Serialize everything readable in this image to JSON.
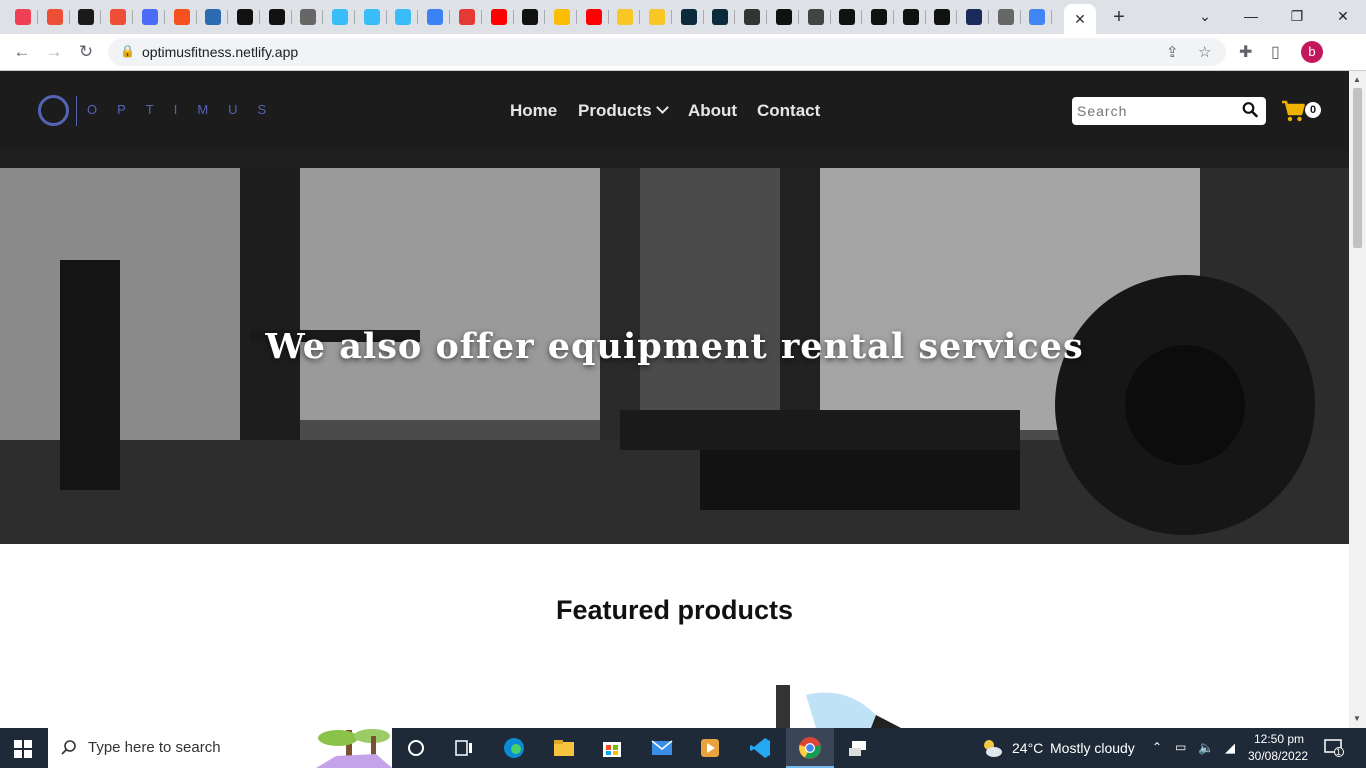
{
  "browser": {
    "url": "optimusfitness.netlify.app",
    "tabs": [
      {
        "icon": "pocket-icon",
        "color": "#ef4056"
      },
      {
        "icon": "asterisk-icon",
        "color": "#ef4e36"
      },
      {
        "icon": "chart-icon",
        "color": "#1a1a1a"
      },
      {
        "icon": "asterisk-icon",
        "color": "#ef4e36"
      },
      {
        "icon": "puzzle-icon",
        "color": "#4a6cf7"
      },
      {
        "icon": "flame-icon",
        "color": "#f4511e"
      },
      {
        "icon": "arrow-icon",
        "color": "#2b6cb0"
      },
      {
        "icon": "circle-icon",
        "color": "#111111"
      },
      {
        "icon": "github-icon",
        "color": "#111111"
      },
      {
        "icon": "globe-icon",
        "color": "#666666"
      },
      {
        "icon": "tailwind-icon",
        "color": "#38bdf8"
      },
      {
        "icon": "tailwind-icon",
        "color": "#38bdf8"
      },
      {
        "icon": "tailwind-icon",
        "color": "#38bdf8"
      },
      {
        "icon": "bot-icon",
        "color": "#3b82f6"
      },
      {
        "icon": "bolt-icon",
        "color": "#e53935"
      },
      {
        "icon": "youtube-icon",
        "color": "#ff0000"
      },
      {
        "icon": "github-icon",
        "color": "#111111"
      },
      {
        "icon": "drive-icon",
        "color": "#fbbc04"
      },
      {
        "icon": "youtube-icon",
        "color": "#ff0000"
      },
      {
        "icon": "sun-icon",
        "color": "#f9c623"
      },
      {
        "icon": "sun-icon",
        "color": "#f9c623"
      },
      {
        "icon": "react-icon",
        "color": "#0b2a3c"
      },
      {
        "icon": "react-icon",
        "color": "#0b2a3c"
      },
      {
        "icon": "w-icon",
        "color": "#333333"
      },
      {
        "icon": "a-icon",
        "color": "#111111"
      },
      {
        "icon": "person-icon",
        "color": "#444444"
      },
      {
        "icon": "n-icon",
        "color": "#111111"
      },
      {
        "icon": "d-icon",
        "color": "#111111"
      },
      {
        "icon": "a-icon",
        "color": "#111111"
      },
      {
        "icon": "terminal-icon",
        "color": "#111111"
      },
      {
        "icon": "c-icon",
        "color": "#1a2b5a"
      },
      {
        "icon": "globe-icon",
        "color": "#666666"
      },
      {
        "icon": "google-icon",
        "color": "#4285f4"
      }
    ],
    "tab_close_label": "✕",
    "new_tab_label": "+",
    "profile_letter": "b"
  },
  "site": {
    "logo_text": "OPTIMUS",
    "nav": {
      "home": "Home",
      "products": "Products",
      "about": "About",
      "contact": "Contact"
    },
    "search_placeholder": "Search",
    "cart_count": "0",
    "hero_title": "We also offer equipment rental services",
    "featured_title": "Featured products",
    "colors": {
      "header_bg": "#1c1c1c",
      "logo": "#5563b5",
      "cart": "#f0b400"
    }
  },
  "taskbar": {
    "search_placeholder": "Type here to search",
    "weather_temp": "24°C",
    "weather_text": "Mostly cloudy",
    "time": "12:50 pm",
    "date": "30/08/2022",
    "notification_count": "1"
  }
}
